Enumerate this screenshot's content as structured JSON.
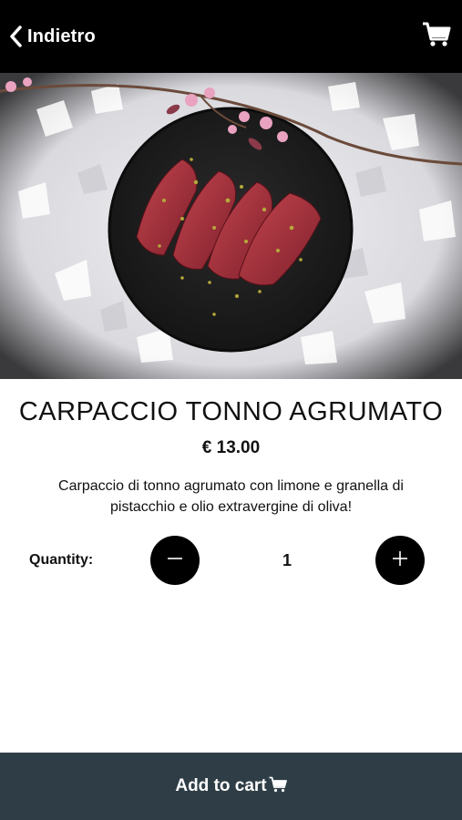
{
  "header": {
    "back_label": "Indietro",
    "back_icon": "chevron-left-icon",
    "cart_icon": "cart-icon"
  },
  "product": {
    "image_alt": "carpaccio plate",
    "title": "CARPACCIO TONNO AGRUMATO",
    "price": "€ 13.00",
    "description": "Carpaccio di tonno agrumato con limone e granella di pistacchio e olio extravergine di oliva!"
  },
  "quantity": {
    "label": "Quantity:",
    "value": "1",
    "minus_icon": "minus-icon",
    "plus_icon": "plus-icon"
  },
  "footer": {
    "add_label": "Add to cart",
    "cart_icon": "cart-icon"
  },
  "colors": {
    "header_bg": "#000000",
    "footer_bg": "#2f3e46",
    "button_bg": "#000000"
  }
}
